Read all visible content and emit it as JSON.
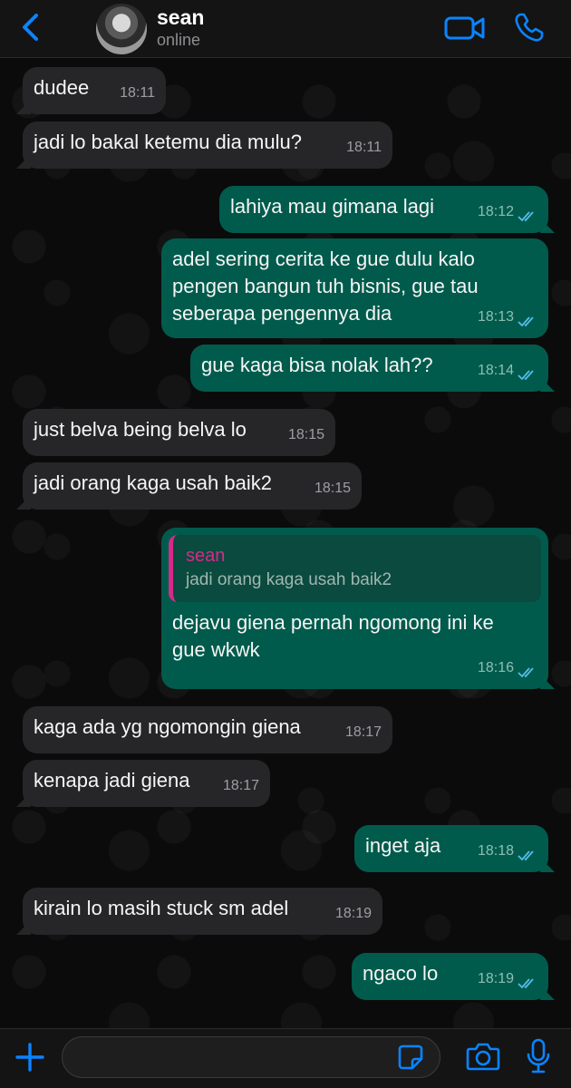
{
  "header": {
    "contact_name": "sean",
    "status": "online"
  },
  "icons": {
    "back": "chevron-left-icon",
    "video": "video-camera-icon",
    "call": "phone-icon",
    "add": "plus-icon",
    "sticker": "sticker-icon",
    "camera": "camera-icon",
    "mic": "microphone-icon",
    "read_receipt": "double-check-icon"
  },
  "colors": {
    "accent_blue": "#0a84ff",
    "incoming_bubble": "#262628",
    "outgoing_bubble": "#015b4c",
    "quote_author": "#d62a8a",
    "read_tick": "#53bdeb"
  },
  "messages": [
    {
      "direction": "in",
      "text": "dudee",
      "time": "18:11"
    },
    {
      "direction": "in",
      "text": "jadi lo bakal ketemu dia mulu?",
      "time": "18:11"
    },
    {
      "direction": "out",
      "text": "lahiya mau gimana lagi",
      "time": "18:12"
    },
    {
      "direction": "out",
      "text": "adel sering cerita ke gue dulu kalo pengen bangun tuh bisnis, gue tau seberapa pengennya dia",
      "time": "18:13"
    },
    {
      "direction": "out",
      "text": "gue kaga bisa nolak lah??",
      "time": "18:14"
    },
    {
      "direction": "in",
      "text": "just belva being belva lo",
      "time": "18:15"
    },
    {
      "direction": "in",
      "text": "jadi orang kaga usah baik2",
      "time": "18:15"
    },
    {
      "direction": "out",
      "text": "dejavu giena pernah ngomong ini ke gue wkwk",
      "time": "18:16",
      "quote": {
        "author": "sean",
        "text": "jadi orang kaga usah baik2"
      }
    },
    {
      "direction": "in",
      "text": "kaga ada yg ngomongin giena",
      "time": "18:17"
    },
    {
      "direction": "in",
      "text": "kenapa jadi giena",
      "time": "18:17"
    },
    {
      "direction": "out",
      "text": "inget aja",
      "time": "18:18"
    },
    {
      "direction": "in",
      "text": "kirain lo masih stuck sm adel",
      "time": "18:19"
    },
    {
      "direction": "out",
      "text": "ngaco lo",
      "time": "18:19"
    }
  ],
  "input": {
    "value": "",
    "placeholder": ""
  }
}
